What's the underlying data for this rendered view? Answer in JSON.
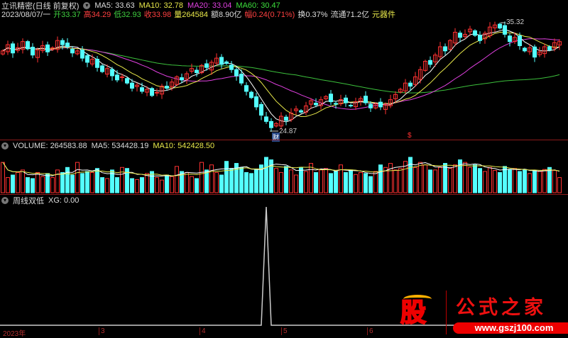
{
  "header": {
    "title": "立讯精密(日线 前复权)",
    "ma5": "MA5: 33.63",
    "ma10": "MA10: 32.78",
    "ma20": "MA20: 33.04",
    "ma60": "MA60: 30.47"
  },
  "quote": {
    "date": "2023/08/07/一",
    "open": "开33.37",
    "high": "高34.29",
    "low": "低32.93",
    "close": "收33.98",
    "volume": "量264584",
    "amount": "额8.90亿",
    "change": "幅0.24(0.71%)",
    "turnover": "换0.37%",
    "float": "流通71.2亿",
    "sector": "元器件"
  },
  "volume_header": {
    "volume": "VOLUME: 264583.88",
    "ma5": "MA5: 534428.19",
    "ma10": "MA10: 542428.50"
  },
  "indicator_header": {
    "name": "周线双低",
    "value": "XG: 0.00"
  },
  "annotations": {
    "high_label": "35.32",
    "low_label": "24.87",
    "finance_marker": "财",
    "dollar_marker": "$"
  },
  "axis": {
    "labels": [
      "2023年",
      "3",
      "4",
      "5",
      "6"
    ]
  },
  "watermark": {
    "logo": "股",
    "brand": "公式之家",
    "url": "www.gszj100.com"
  },
  "colors": {
    "up": "#ff3232",
    "down": "#54ffff",
    "ma5": "#ffffff",
    "ma10": "#e8e84a",
    "ma20": "#e040e0",
    "ma60": "#3cc03c"
  },
  "chart_data": {
    "type": "candlestick",
    "price_range": [
      24.87,
      35.32
    ],
    "closes": [
      32.6,
      33.2,
      32.4,
      32.9,
      33.5,
      32.8,
      32.2,
      32.7,
      33.1,
      32.5,
      32.9,
      33.6,
      33.2,
      33.0,
      32.4,
      32.6,
      31.9,
      31.5,
      31.8,
      31.0,
      30.6,
      30.9,
      30.2,
      29.8,
      30.1,
      29.5,
      29.0,
      29.3,
      28.7,
      28.9,
      28.3,
      28.6,
      29.2,
      29.0,
      29.6,
      30.1,
      29.8,
      30.4,
      30.9,
      30.5,
      31.2,
      31.0,
      31.5,
      31.9,
      31.3,
      31.4,
      30.8,
      30.2,
      29.5,
      28.7,
      28.1,
      27.2,
      26.4,
      25.8,
      25.2,
      25.6,
      26.3,
      25.9,
      26.6,
      27.0,
      26.7,
      27.3,
      27.8,
      27.4,
      27.9,
      28.2,
      27.7,
      27.5,
      27.9,
      27.6,
      27.3,
      27.7,
      28.0,
      27.6,
      27.1,
      27.5,
      27.2,
      27.4,
      27.9,
      28.4,
      28.9,
      29.5,
      29.2,
      30.1,
      30.8,
      31.6,
      31.3,
      32.2,
      33.0,
      32.6,
      33.6,
      34.4,
      33.9,
      34.2,
      34.7,
      34.1,
      33.6,
      34.3,
      34.9,
      35.1,
      34.8,
      34.2,
      33.5,
      33.9,
      33.1,
      32.6,
      32.9,
      32.0,
      32.5,
      33.0,
      32.7,
      33.4,
      33.5
    ],
    "volumes": [
      60,
      30,
      35,
      40,
      45,
      30,
      28,
      40,
      32,
      38,
      30,
      45,
      40,
      50,
      35,
      60,
      38,
      42,
      40,
      48,
      30,
      28,
      45,
      30,
      50,
      48,
      28,
      26,
      30,
      38,
      42,
      30,
      25,
      35,
      32,
      52,
      42,
      40,
      32,
      28,
      60,
      45,
      55,
      40,
      35,
      62,
      48,
      58,
      50,
      40,
      38,
      45,
      55,
      70,
      65,
      48,
      40,
      52,
      45,
      35,
      50,
      42,
      58,
      40,
      45,
      48,
      38,
      42,
      55,
      40,
      45,
      36,
      40,
      38,
      32,
      42,
      55,
      50,
      58,
      45,
      48,
      62,
      70,
      50,
      60,
      55,
      45,
      45,
      50,
      58,
      48,
      55,
      65,
      60,
      50,
      55,
      48,
      42,
      50,
      44,
      40,
      52,
      46,
      48,
      42,
      46,
      38,
      44,
      42,
      46,
      50,
      44,
      30
    ],
    "xg_signal_index": 53
  }
}
